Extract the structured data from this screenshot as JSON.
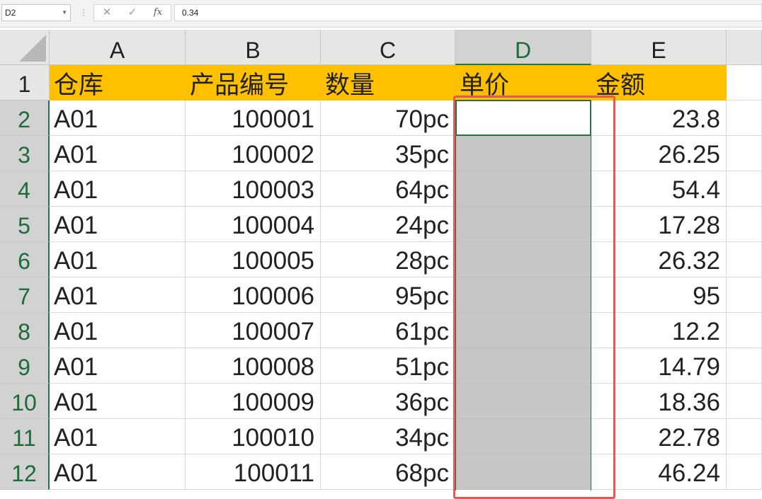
{
  "formula_bar": {
    "name_box": "D2",
    "cancel_icon": "✕",
    "enter_icon": "✓",
    "fx_label": "fx",
    "value": "0.34"
  },
  "columns": [
    "A",
    "B",
    "C",
    "D",
    "E"
  ],
  "header_row": {
    "row_number": "1",
    "cells": [
      "仓库",
      "产品编号",
      "数量",
      "单价",
      "金额"
    ]
  },
  "rows": [
    {
      "n": "2",
      "a": "A01",
      "b": "100001",
      "c": "70pc",
      "d": "",
      "e": "23.8"
    },
    {
      "n": "3",
      "a": "A01",
      "b": "100002",
      "c": "35pc",
      "d": "",
      "e": "26.25"
    },
    {
      "n": "4",
      "a": "A01",
      "b": "100003",
      "c": "64pc",
      "d": "",
      "e": "54.4"
    },
    {
      "n": "5",
      "a": "A01",
      "b": "100004",
      "c": "24pc",
      "d": "",
      "e": "17.28"
    },
    {
      "n": "6",
      "a": "A01",
      "b": "100005",
      "c": "28pc",
      "d": "",
      "e": "26.32"
    },
    {
      "n": "7",
      "a": "A01",
      "b": "100006",
      "c": "95pc",
      "d": "",
      "e": "95"
    },
    {
      "n": "8",
      "a": "A01",
      "b": "100007",
      "c": "61pc",
      "d": "",
      "e": "12.2"
    },
    {
      "n": "9",
      "a": "A01",
      "b": "100008",
      "c": "51pc",
      "d": "",
      "e": "14.79"
    },
    {
      "n": "10",
      "a": "A01",
      "b": "100009",
      "c": "36pc",
      "d": "",
      "e": "18.36"
    },
    {
      "n": "11",
      "a": "A01",
      "b": "100010",
      "c": "34pc",
      "d": "",
      "e": "22.78"
    },
    {
      "n": "12",
      "a": "A01",
      "b": "100011",
      "c": "68pc",
      "d": "",
      "e": "46.24"
    }
  ],
  "colors": {
    "header_fill": "#ffc000",
    "selection_gray": "#c6c6c6",
    "active_border": "#217346",
    "highlight_box": "#e05a5a"
  }
}
